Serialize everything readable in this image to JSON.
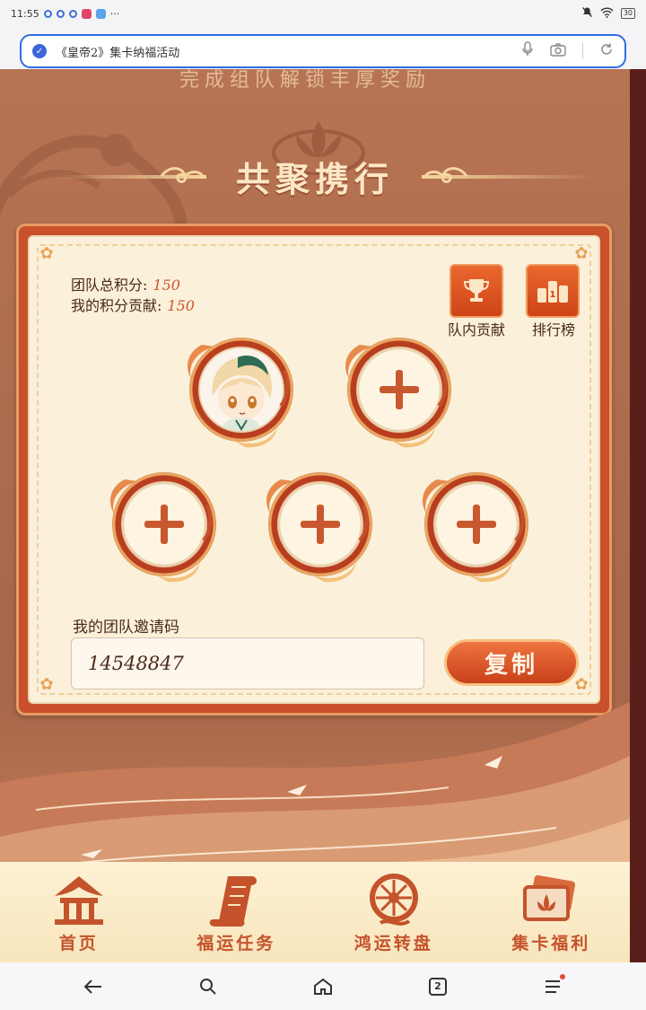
{
  "status_bar": {
    "time": "11:55",
    "more": "···",
    "battery": "30"
  },
  "browser": {
    "url_title": "《皇帝2》集卡纳福活动"
  },
  "page": {
    "faded_banner": "完成组队解锁丰厚奖励",
    "section_title": "共聚携行",
    "team_total_label": "团队总积分:",
    "team_total_value": "150",
    "my_contrib_label": "我的积分贡献:",
    "my_contrib_value": "150",
    "team_contrib_label": "队内贡献",
    "ranking_label": "排行榜",
    "invite_label": "我的团队邀请码",
    "invite_code": "14548847",
    "copy_label": "复制"
  },
  "slots": [
    {
      "state": "filled"
    },
    {
      "state": "empty"
    },
    {
      "state": "empty"
    },
    {
      "state": "empty"
    },
    {
      "state": "empty"
    }
  ],
  "bottom_nav": [
    {
      "label": "首页",
      "icon": "pavilion-icon"
    },
    {
      "label": "福运任务",
      "icon": "scroll-icon"
    },
    {
      "label": "鸿运转盘",
      "icon": "wheel-icon"
    },
    {
      "label": "集卡福利",
      "icon": "cards-icon"
    }
  ],
  "sys_nav": {
    "tab_count": "2"
  },
  "colors": {
    "accent": "#d2532c",
    "brand_red": "#c9502b",
    "card_bg": "#fbf0da",
    "nav_text": "#c4532b"
  }
}
